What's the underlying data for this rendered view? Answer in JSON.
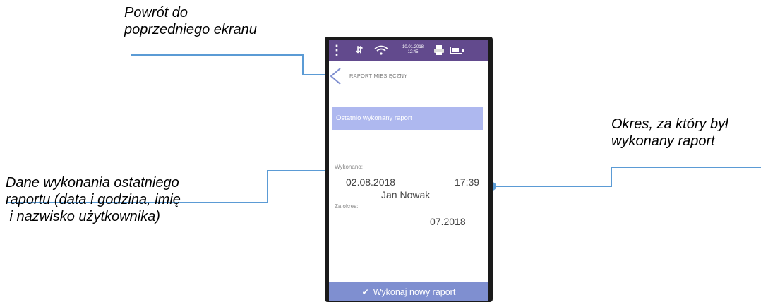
{
  "callouts": {
    "back": [
      "Powrót do",
      "poprzedniego ekranu"
    ],
    "last_report_data": [
      "Dane wykonania ostatniego",
      "raportu (data i godzina, imię",
      " i nazwisko użytkownika)"
    ],
    "period": [
      "Okres, za który był",
      "wykonany raport"
    ]
  },
  "status_bar": {
    "date": "10.01.2018",
    "time": "12:45",
    "icons": [
      "menu-dots-icon",
      "signal-arrows-icon",
      "wifi-icon",
      "printer-icon",
      "battery-icon"
    ],
    "color": "#624a8d"
  },
  "screen": {
    "title": "RAPORT MIESIĘCZNY",
    "banner": "Ostatnio wykonany raport",
    "executed_label": "Wykonano:",
    "executed_date": "02.08.2018",
    "executed_time": "17:39",
    "user_name": "Jan Nowak",
    "period_label": "Za okres:",
    "period_value": "07.2018",
    "action_button": "Wykonaj nowy raport"
  },
  "colors": {
    "banner": "#aeb8ef",
    "button": "#7f8fd0",
    "callout_line": "#5b9bd5"
  }
}
